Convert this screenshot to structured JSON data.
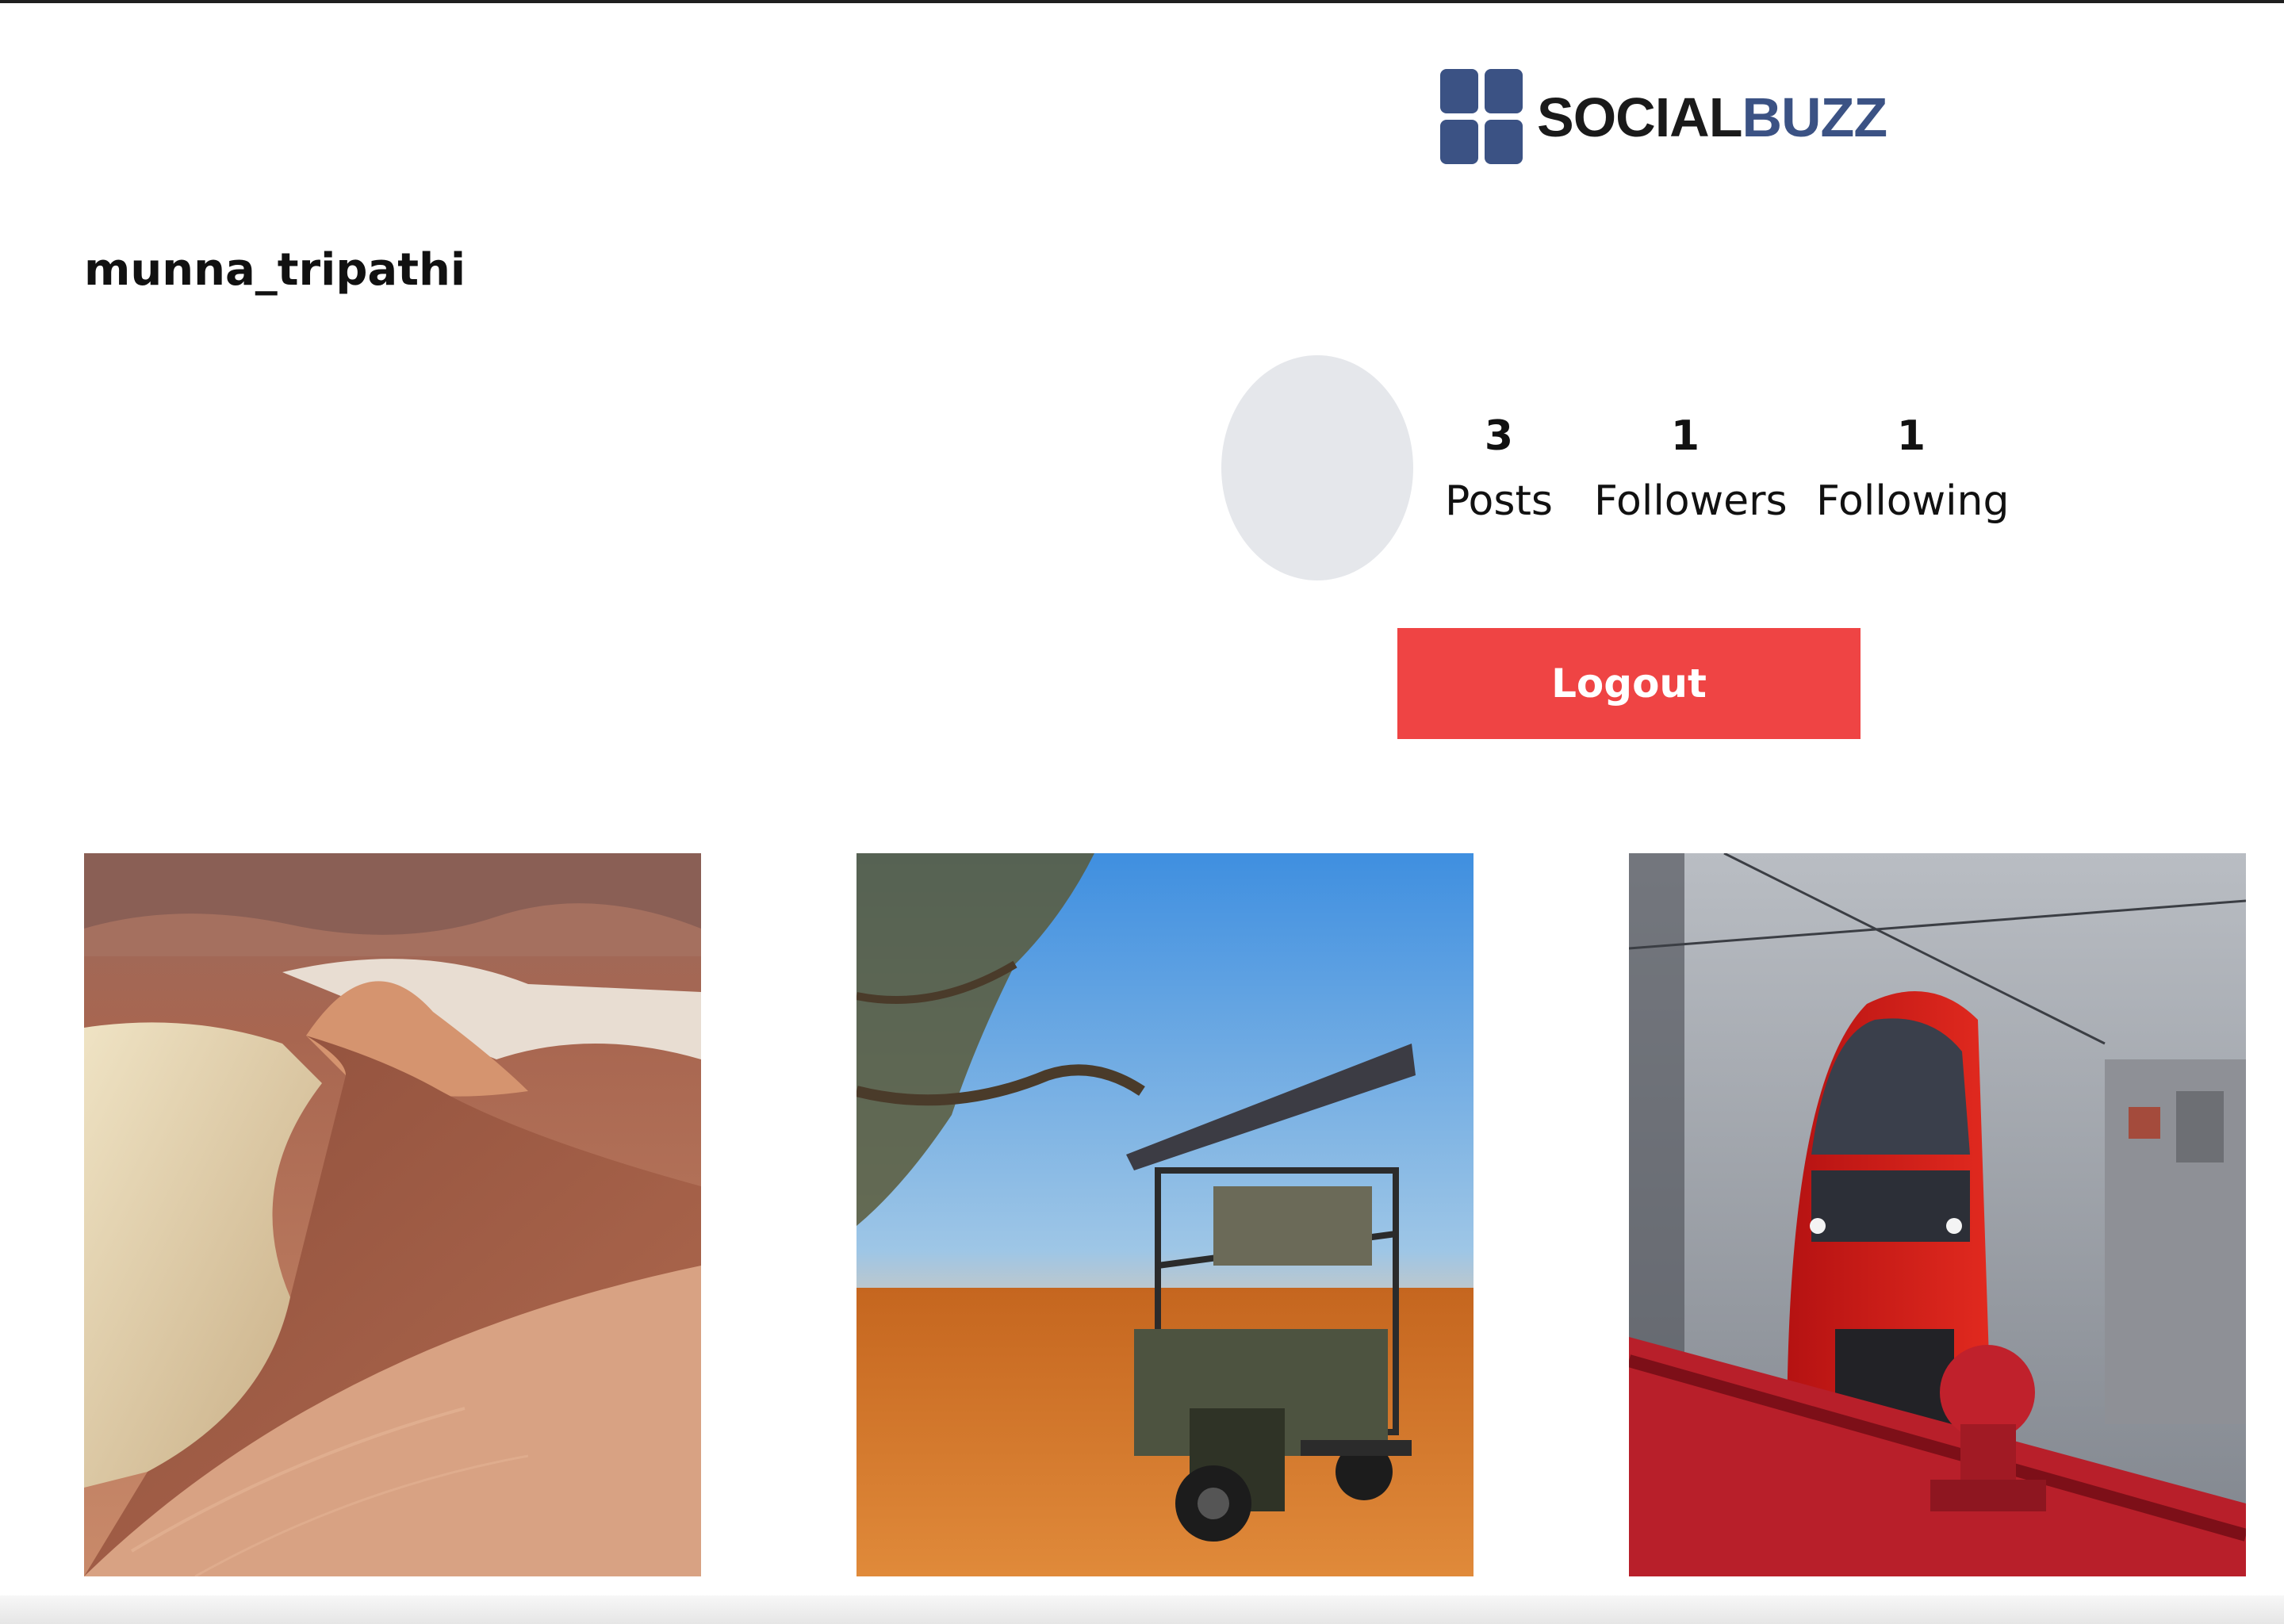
{
  "brand": {
    "part1": "SOCIAL",
    "part2": "BUZZ",
    "colors": {
      "dark": "#1a1a1a",
      "accent": "#3b5284"
    }
  },
  "profile": {
    "username": "munna_tripathi",
    "stats": [
      {
        "value": "3",
        "label": "Posts"
      },
      {
        "value": "1",
        "label": "Followers"
      },
      {
        "value": "1",
        "label": "Following"
      }
    ],
    "logout_label": "Logout"
  },
  "posts": [
    {
      "image": "desert-dunes-photo"
    },
    {
      "image": "safari-jeep-photo"
    },
    {
      "image": "red-train-photo"
    }
  ],
  "colors": {
    "logout_button": "#ef4444",
    "avatar_placeholder": "#e5e7eb"
  }
}
